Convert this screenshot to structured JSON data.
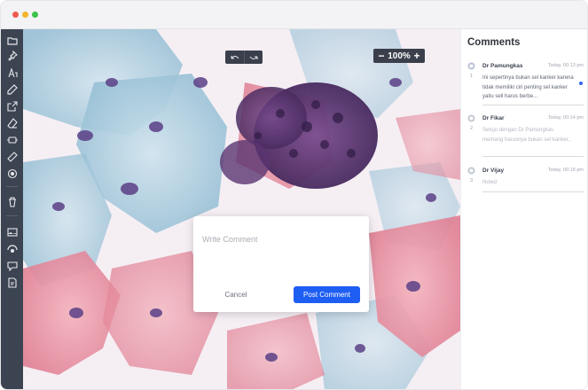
{
  "toolbar": {
    "tools": [
      {
        "icon": "folder-icon",
        "label": ""
      },
      {
        "icon": "pin-icon",
        "label": ""
      },
      {
        "icon": "text-tool-icon",
        "label": ""
      },
      {
        "icon": "pencil-icon",
        "label": ""
      },
      {
        "icon": "export-icon",
        "label": ""
      },
      {
        "icon": "eraser-icon",
        "label": ""
      },
      {
        "icon": "stamp-icon",
        "label": ""
      },
      {
        "icon": "ruler-icon",
        "label": ""
      },
      {
        "icon": "target-icon",
        "label": ""
      },
      {
        "icon": "trash-icon",
        "label": ""
      },
      {
        "icon": "image-icon",
        "label": ""
      },
      {
        "icon": "view-icon",
        "label": ""
      },
      {
        "icon": "comment-tool-icon",
        "label": ""
      },
      {
        "icon": "report-icon",
        "label": ""
      }
    ]
  },
  "viewer": {
    "undo_icon": "undo-icon",
    "redo_icon": "redo-icon",
    "zoom": {
      "minus": "−",
      "value": "100%",
      "plus": "+"
    }
  },
  "comment_dialog": {
    "placeholder": "Write Comment",
    "cancel_label": "Cancel",
    "post_label": "Post Comment"
  },
  "comments_panel": {
    "title": "Comments",
    "items": [
      {
        "number": "1",
        "author": "Dr Pamungkas",
        "time": "Today, 00:13 pm",
        "text": "Ini sepertinya bukan sel kanker karena tidak memiliki ciri penting sel kanker yaitu sell harus berbe...",
        "unread": true,
        "icon": "comment-bubble-icon"
      },
      {
        "number": "2",
        "author": "Dr Fikar",
        "time": "Today, 00:14 pm",
        "text": "Setuju dengan Dr Pamungkas memang harusnya bukan sel kanker..",
        "unread": false,
        "icon": "comment-bubble-icon"
      },
      {
        "number": "3",
        "author": "Dr Vijay",
        "time": "Today, 00:18 pm",
        "text": "Noted",
        "unread": false,
        "icon": "comment-bubble-icon"
      }
    ]
  },
  "colors": {
    "toolbar_bg": "#3c4452",
    "accent": "#1e5ef3",
    "unread_dot": "#2f63f0"
  }
}
